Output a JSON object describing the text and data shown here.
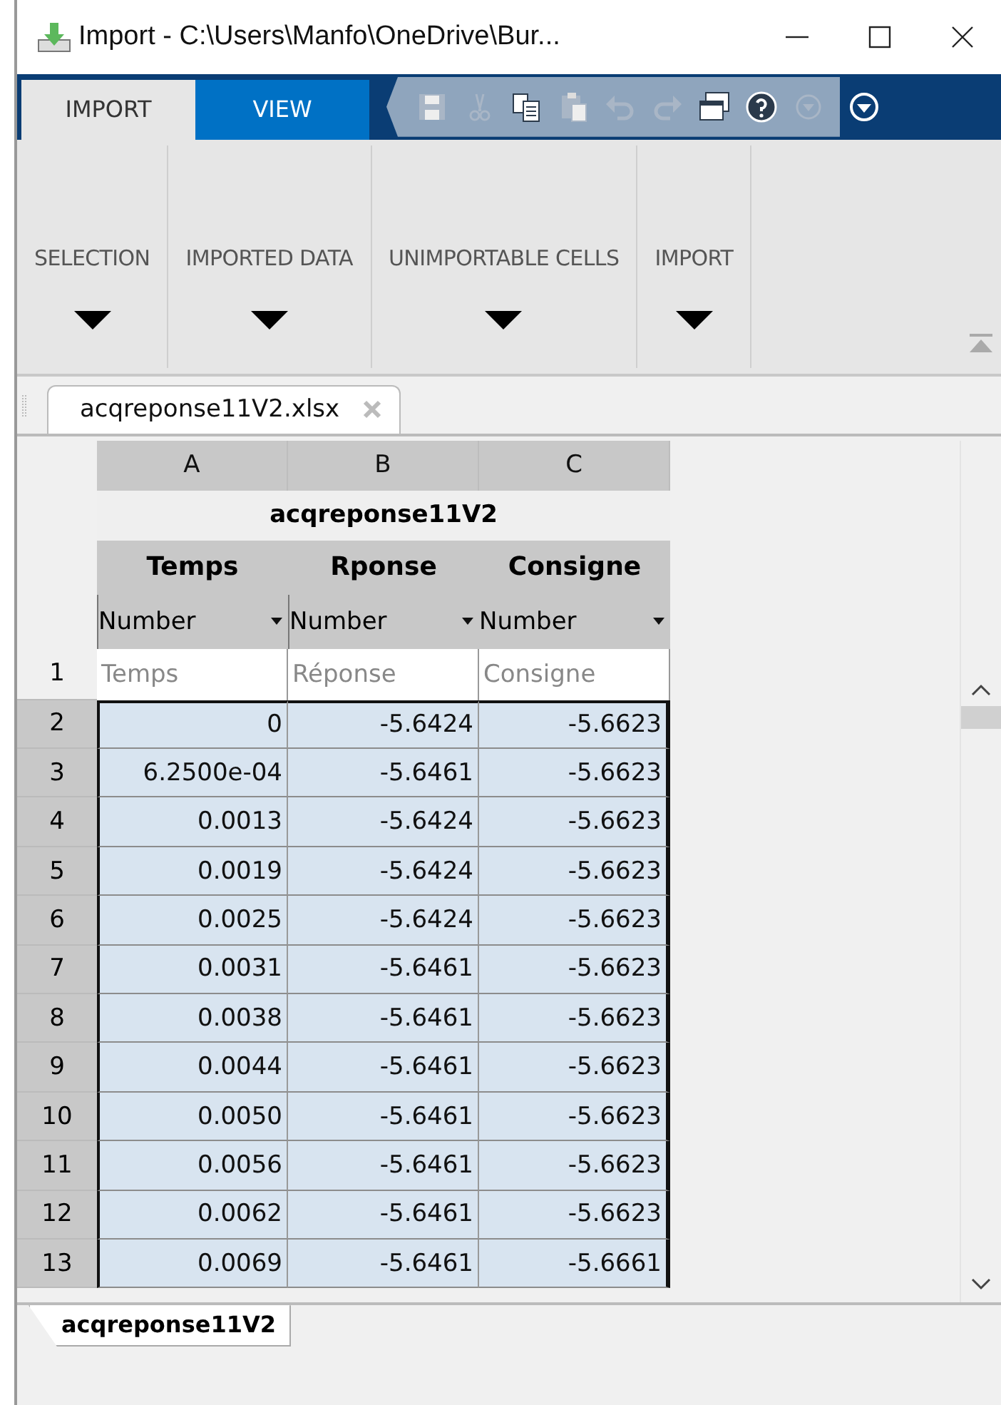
{
  "window": {
    "title": "Import - C:\\Users\\Manfo\\OneDrive\\Bur..."
  },
  "tabs": [
    {
      "label": "IMPORT",
      "selected": true
    },
    {
      "label": "VIEW",
      "selected": false
    }
  ],
  "quick_access": [
    {
      "kind": "save",
      "disabled": true
    },
    {
      "kind": "cut",
      "disabled": true
    },
    {
      "kind": "copy",
      "disabled": false
    },
    {
      "kind": "paste",
      "disabled": true
    },
    {
      "kind": "undo",
      "disabled": true
    },
    {
      "kind": "redo",
      "disabled": true
    },
    {
      "kind": "windows",
      "disabled": false
    },
    {
      "kind": "help",
      "disabled": false
    },
    {
      "kind": "more",
      "disabled": true
    }
  ],
  "ribbon_sections": [
    {
      "label": "SELECTION"
    },
    {
      "label": "IMPORTED DATA"
    },
    {
      "label": "UNIMPORTABLE CELLS"
    },
    {
      "label": "IMPORT"
    }
  ],
  "file_tabs": [
    {
      "label": "acqreponse11V2.xlsx",
      "selected": true
    }
  ],
  "table": {
    "variable": "acqreponse11V2",
    "columns": [
      {
        "letter": "A",
        "name": "Temps",
        "type": "Number"
      },
      {
        "letter": "B",
        "name": "Rponse",
        "type": "Number"
      },
      {
        "letter": "C",
        "name": "Consigne",
        "type": "Number"
      }
    ],
    "rows": [
      {
        "number": "1",
        "selected": false,
        "cells": [
          "Temps",
          "Réponse",
          "Consigne"
        ]
      },
      {
        "number": "2",
        "selected": true,
        "cells": [
          "0",
          "-5.6424",
          "-5.6623"
        ]
      },
      {
        "number": "3",
        "selected": true,
        "cells": [
          "6.2500e-04",
          "-5.6461",
          "-5.6623"
        ]
      },
      {
        "number": "4",
        "selected": true,
        "cells": [
          "0.0013",
          "-5.6424",
          "-5.6623"
        ]
      },
      {
        "number": "5",
        "selected": true,
        "cells": [
          "0.0019",
          "-5.6424",
          "-5.6623"
        ]
      },
      {
        "number": "6",
        "selected": true,
        "cells": [
          "0.0025",
          "-5.6424",
          "-5.6623"
        ]
      },
      {
        "number": "7",
        "selected": true,
        "cells": [
          "0.0031",
          "-5.6461",
          "-5.6623"
        ]
      },
      {
        "number": "8",
        "selected": true,
        "cells": [
          "0.0038",
          "-5.6461",
          "-5.6623"
        ]
      },
      {
        "number": "9",
        "selected": true,
        "cells": [
          "0.0044",
          "-5.6461",
          "-5.6623"
        ]
      },
      {
        "number": "10",
        "selected": true,
        "cells": [
          "0.0050",
          "-5.6461",
          "-5.6623"
        ]
      },
      {
        "number": "11",
        "selected": true,
        "cells": [
          "0.0056",
          "-5.6461",
          "-5.6623"
        ]
      },
      {
        "number": "12",
        "selected": true,
        "cells": [
          "0.0062",
          "-5.6461",
          "-5.6623"
        ]
      },
      {
        "number": "13",
        "selected": true,
        "cells": [
          "0.0069",
          "-5.6461",
          "-5.6661"
        ]
      }
    ]
  },
  "sheet_tabs": [
    {
      "label": "acqreponse11V2",
      "selected": true
    }
  ]
}
